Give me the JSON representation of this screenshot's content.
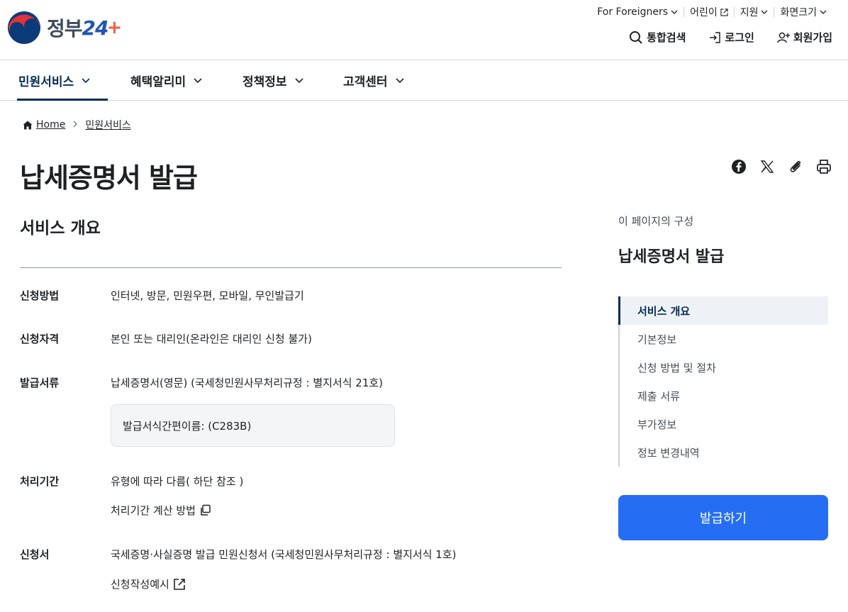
{
  "header": {
    "logo_text": "정부",
    "logo_num": "24",
    "logo_plus": "+",
    "utility": {
      "foreigners": "For Foreigners",
      "kids": "어린이",
      "support": "지원",
      "screen_size": "화면크기"
    },
    "actions": {
      "search": "통합검색",
      "login": "로그인",
      "signup": "회원가입"
    }
  },
  "gnb": {
    "items": [
      {
        "label": "민원서비스",
        "active": true
      },
      {
        "label": "혜택알리미",
        "active": false
      },
      {
        "label": "정책정보",
        "active": false
      },
      {
        "label": "고객센터",
        "active": false
      }
    ]
  },
  "breadcrumb": {
    "home": "Home",
    "current": "민원서비스"
  },
  "page": {
    "title": "납세증명서 발급",
    "section_title": "서비스 개요"
  },
  "info": {
    "method": {
      "label": "신청방법",
      "value": "인터넷, 방문, 민원우편, 모바일, 무인발급기"
    },
    "eligibility": {
      "label": "신청자격",
      "value": "본인 또는 대리인(온라인은 대리인 신청 불가)"
    },
    "documents": {
      "label": "발급서류",
      "value": "납세증명서(영문) (국세청민원사무처리규정 : 별지서식 21호)",
      "code_box": "발급서식간편이름: (C283B)"
    },
    "period": {
      "label": "처리기간",
      "value": "유형에 따라 다름( 하단 참조 )",
      "link": "처리기간 계산 방법"
    },
    "form": {
      "label": "신청서",
      "value": "국세증명·사실증명 발급 민원신청서 (국세청민원사무처리규정 : 별지서식 1호)",
      "link": "신청작성예시"
    }
  },
  "toc": {
    "caption": "이 페이지의 구성",
    "title": "납세증명서 발급",
    "items": [
      {
        "label": "서비스 개요",
        "active": true
      },
      {
        "label": "기본정보",
        "active": false
      },
      {
        "label": "신청 방법 및 절차",
        "active": false
      },
      {
        "label": "제출 서류",
        "active": false
      },
      {
        "label": "부가정보",
        "active": false
      },
      {
        "label": "정보 변경내역",
        "active": false
      }
    ]
  },
  "apply_button": "발급하기",
  "share_icons": [
    "facebook-icon",
    "x-icon",
    "clip-icon",
    "print-icon"
  ],
  "colors": {
    "primary": "#256ef4",
    "navy": "#052b57",
    "text": "#1e2124"
  }
}
